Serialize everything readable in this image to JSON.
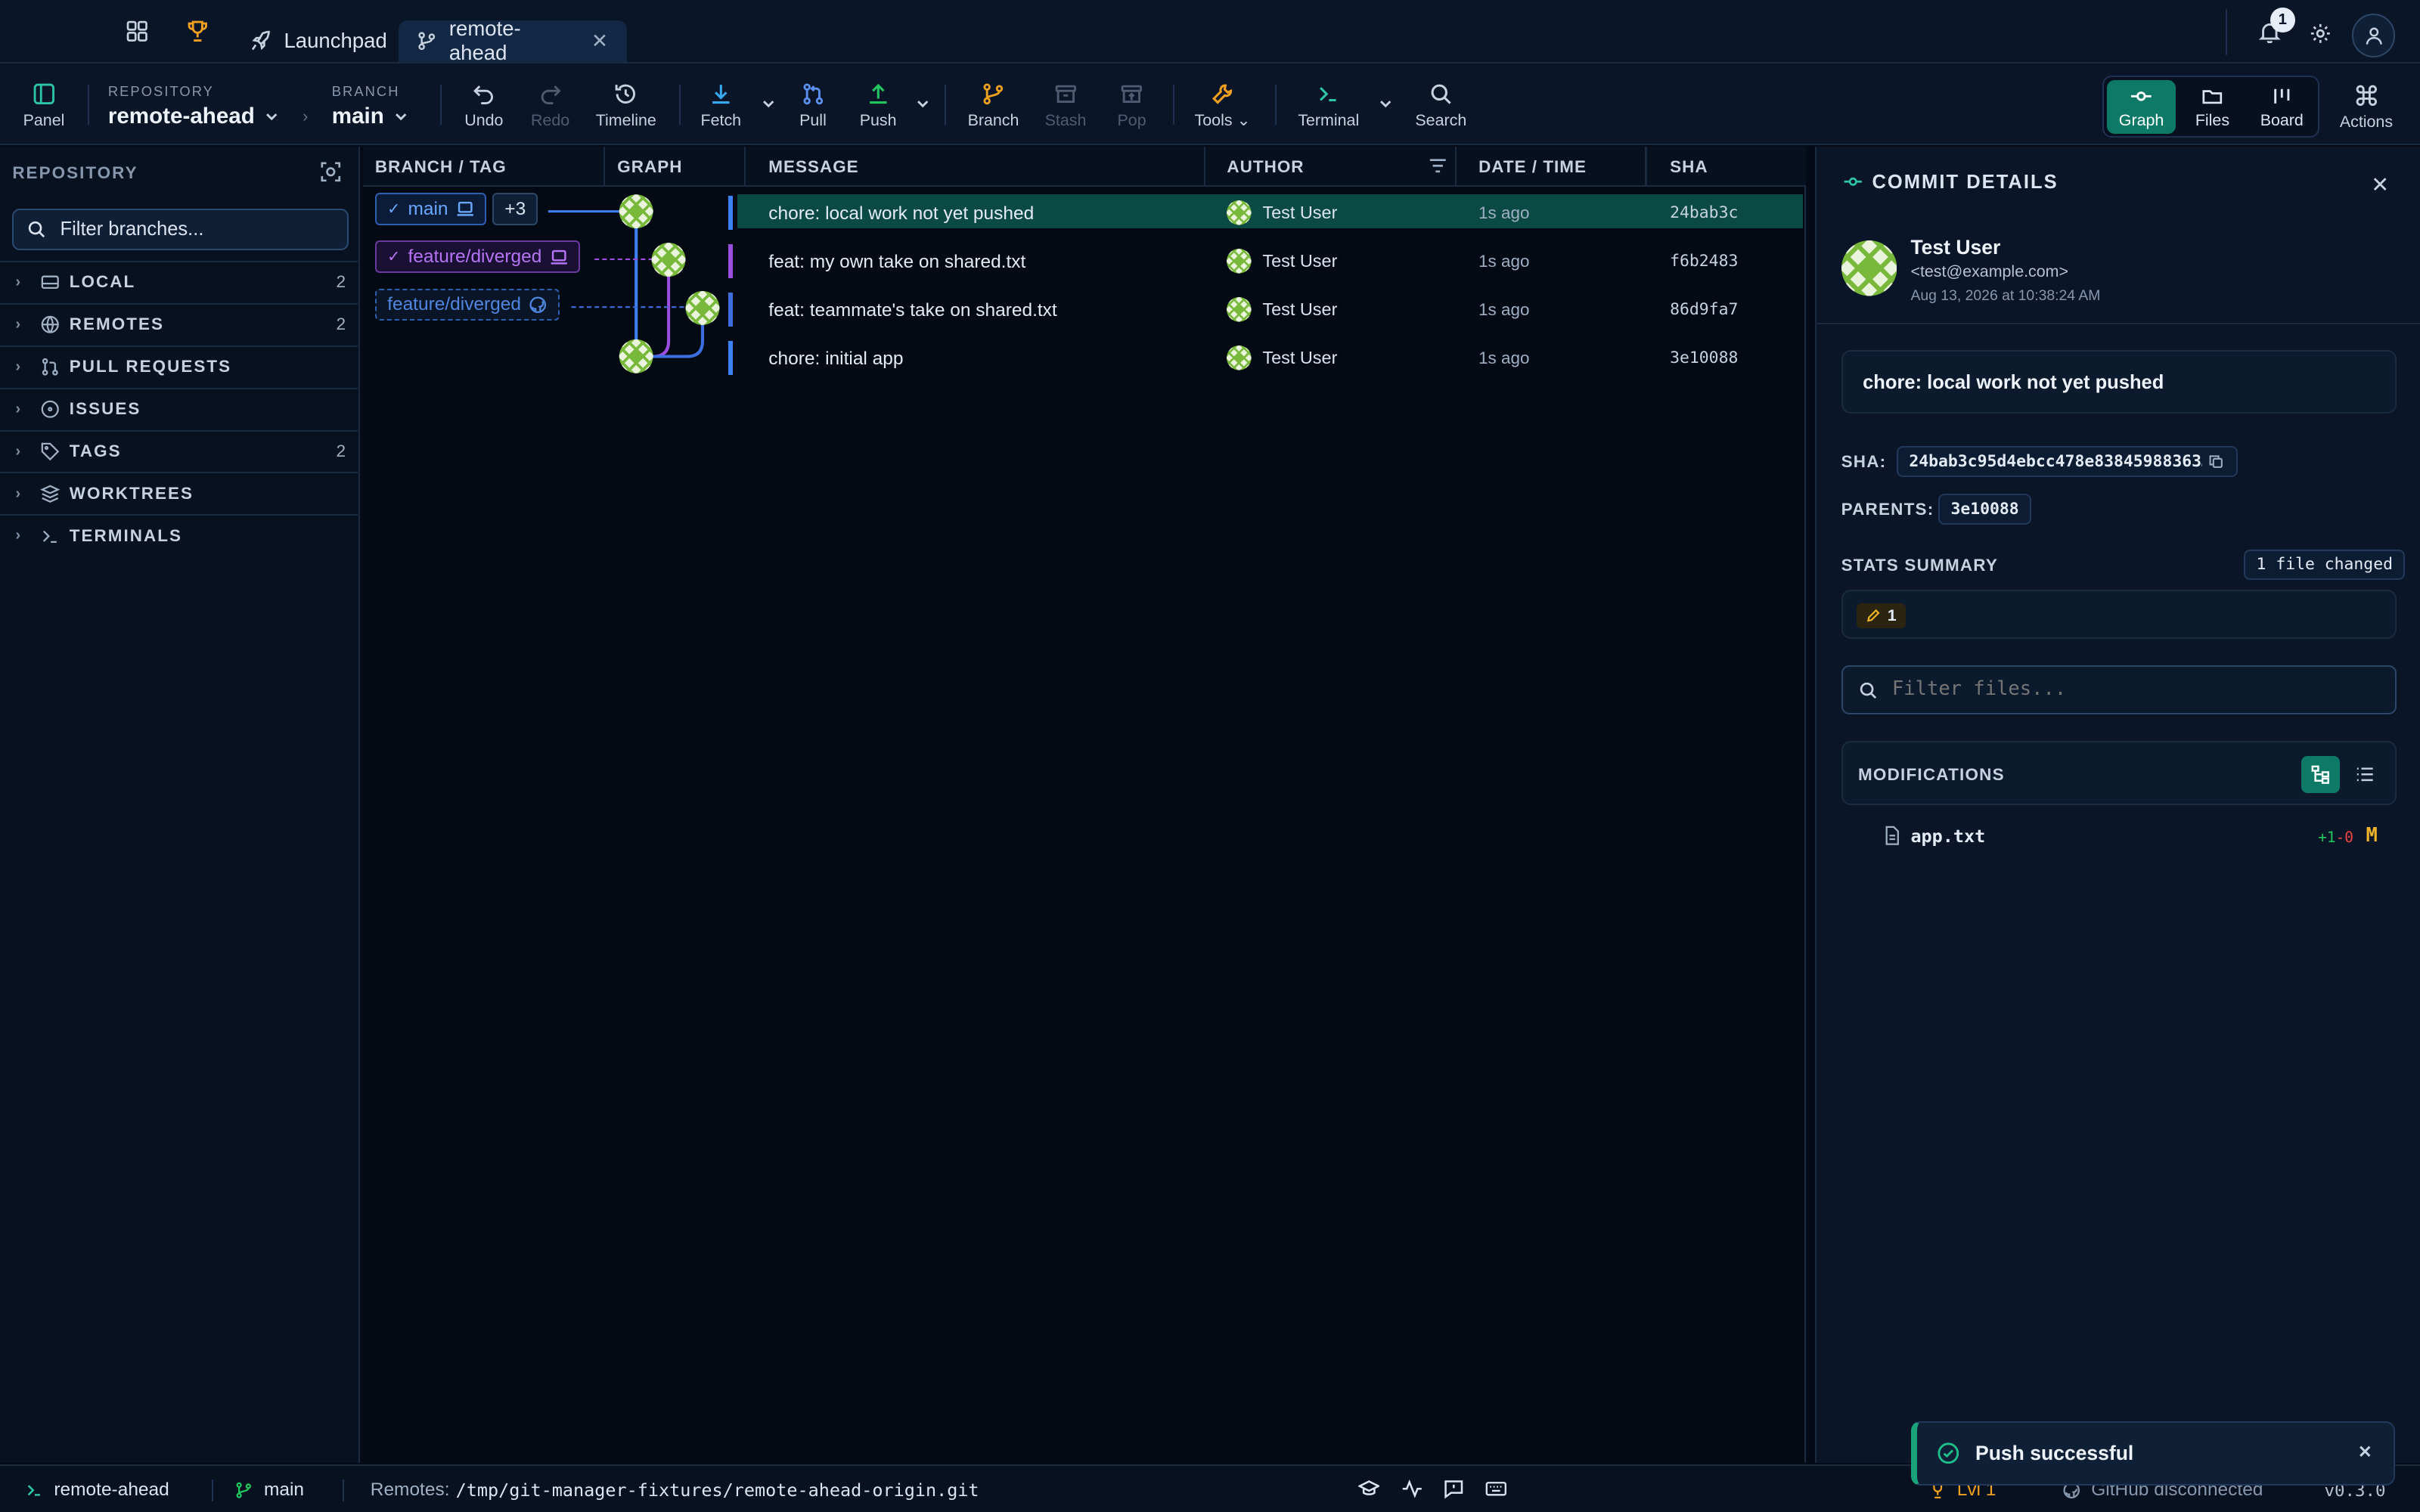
{
  "titlebar": {
    "tabs": [
      {
        "label": "Launchpad",
        "icon": "rocket-icon"
      },
      {
        "label": "remote-ahead",
        "icon": "branch-icon",
        "active": true
      }
    ],
    "notifications_count": "1"
  },
  "toolbar": {
    "panel_label": "Panel",
    "repository_caption": "REPOSITORY",
    "repository_name": "remote-ahead",
    "branch_caption": "BRANCH",
    "branch_name": "main",
    "buttons": {
      "undo": "Undo",
      "redo": "Redo",
      "timeline": "Timeline",
      "fetch": "Fetch",
      "pull": "Pull",
      "push": "Push",
      "branch": "Branch",
      "stash": "Stash",
      "pop": "Pop",
      "tools": "Tools",
      "terminal": "Terminal",
      "search": "Search"
    },
    "views": {
      "graph": "Graph",
      "files": "Files",
      "board": "Board",
      "actions": "Actions"
    }
  },
  "sidebar": {
    "title": "REPOSITORY",
    "filter_placeholder": "Filter branches...",
    "sections": [
      {
        "label": "LOCAL",
        "count": "2",
        "icon": "drive-icon"
      },
      {
        "label": "REMOTES",
        "count": "2",
        "icon": "globe-icon"
      },
      {
        "label": "PULL REQUESTS",
        "count": "",
        "icon": "pull-request-icon"
      },
      {
        "label": "ISSUES",
        "count": "",
        "icon": "issue-icon"
      },
      {
        "label": "TAGS",
        "count": "2",
        "icon": "tag-icon"
      },
      {
        "label": "WORKTREES",
        "count": "",
        "icon": "layers-icon"
      },
      {
        "label": "TERMINALS",
        "count": "",
        "icon": "terminal-icon"
      }
    ]
  },
  "graph": {
    "columns": {
      "branch": "BRANCH / TAG",
      "graph": "GRAPH",
      "message": "MESSAGE",
      "author": "AUTHOR",
      "date": "DATE / TIME",
      "sha": "SHA"
    },
    "refs": {
      "main": "main",
      "main_more": "+3",
      "feature_local": "feature/diverged",
      "feature_remote": "feature/diverged"
    },
    "commits": [
      {
        "message": "chore: local work not yet pushed",
        "author": "Test User",
        "date": "1s ago",
        "sha": "24bab3c",
        "lane_color": "#3b82f6"
      },
      {
        "message": "feat: my own take on shared.txt",
        "author": "Test User",
        "date": "1s ago",
        "sha": "f6b2483",
        "lane_color": "#9b4de0"
      },
      {
        "message": "feat: teammate's take on shared.txt",
        "author": "Test User",
        "date": "1s ago",
        "sha": "86d9fa7",
        "lane_color": "#3b6fe0"
      },
      {
        "message": "chore: initial app",
        "author": "Test User",
        "date": "1s ago",
        "sha": "3e10088",
        "lane_color": "#3b82f6"
      }
    ]
  },
  "details": {
    "title": "COMMIT DETAILS",
    "author_name": "Test User",
    "author_email": "<test@example.com>",
    "date": "Aug 13, 2026 at 10:38:24 AM",
    "subject": "chore: local work not yet pushed",
    "sha_label": "SHA:",
    "sha_value": "24bab3c95d4ebcc478e83845988363…",
    "parents_label": "PARENTS:",
    "parent_value": "3e10088",
    "stats_label": "STATS SUMMARY",
    "files_changed": "1 file changed",
    "modified_count": "1",
    "filter_files_placeholder": "Filter files...",
    "modifications_label": "MODIFICATIONS",
    "files": [
      {
        "name": "app.txt",
        "added": "+1",
        "removed": "-0",
        "status": "M"
      }
    ]
  },
  "statusbar": {
    "repo": "remote-ahead",
    "branch": "main",
    "remotes_label": "Remotes:",
    "remotes_path": "/tmp/git-manager-fixtures/remote-ahead-origin.git",
    "level": "Lvl 1",
    "github": "GitHub disconnected",
    "version": "v0.3.0"
  },
  "toast": {
    "message": "Push successful"
  },
  "colors": {
    "accent": "#0c7a66",
    "lane_blue": "#3b82f6",
    "lane_purple": "#9b4de0",
    "success": "#1aa37a",
    "warning": "#f0b429"
  }
}
